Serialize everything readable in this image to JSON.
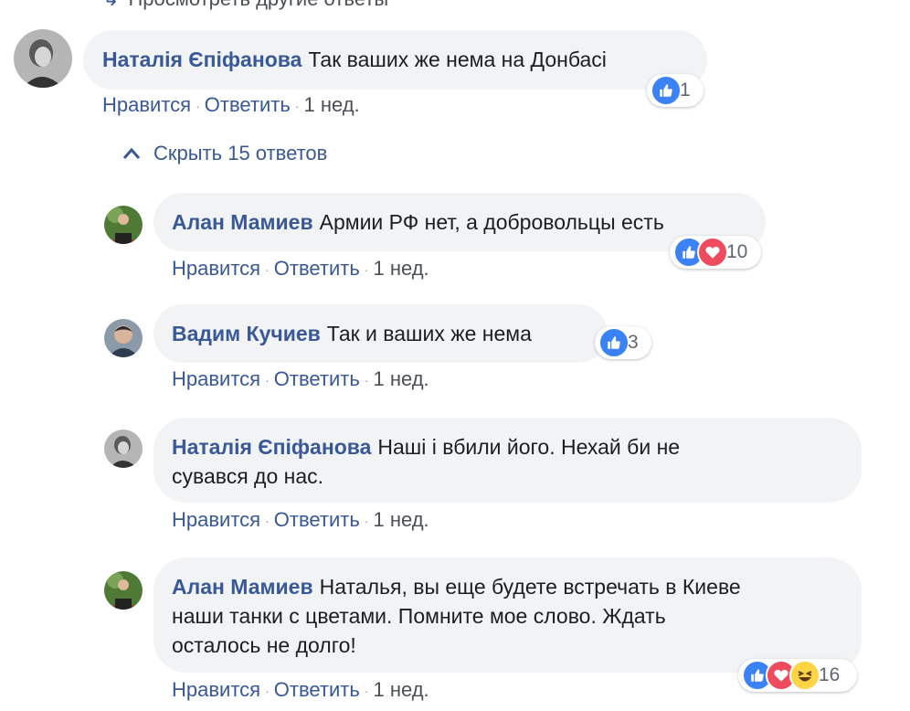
{
  "top_cut_text": "Просмотреть другие ответы",
  "hide_replies": "Скрыть 15 ответов",
  "like_label": "Нравится",
  "reply_label": "Ответить",
  "separator": "·",
  "colors": {
    "link": "#385898",
    "bubble": "#f2f3f5",
    "like": "#3b82f6",
    "love": "#ef4b5f",
    "haha": "#fdd443"
  },
  "comments": [
    {
      "author": "Наталія Єпіфанова",
      "text": "Так ваших же нема на Донбасі",
      "time": "1 нед.",
      "reactions": [
        "like-icon"
      ],
      "count": "1"
    },
    {
      "author": "Алан Мамиев",
      "text": "Армии РФ нет, а добровольцы есть",
      "time": "1 нед.",
      "reactions": [
        "like-icon",
        "love-icon"
      ],
      "count": "10"
    },
    {
      "author": "Вадим Кучиев",
      "text": "Так и ваших же нема",
      "time": "1 нед.",
      "reactions": [
        "like-icon"
      ],
      "count": "3"
    },
    {
      "author": "Наталія Єпіфанова",
      "text_line1": "Наші і вбили його. Нехай би не",
      "text_line2": "сувався до нас.",
      "time": "1 нед."
    },
    {
      "author": "Алан Мамиев",
      "text_line1": "Наталья, вы еще будете встречать в Киеве",
      "text_line2": "наши танки с цветами. Помните мое слово. Ждать",
      "text_line3": "осталось не долго!",
      "time": "1 нед.",
      "reactions": [
        "like-icon",
        "love-icon",
        "haha-icon"
      ],
      "count": "16"
    }
  ]
}
